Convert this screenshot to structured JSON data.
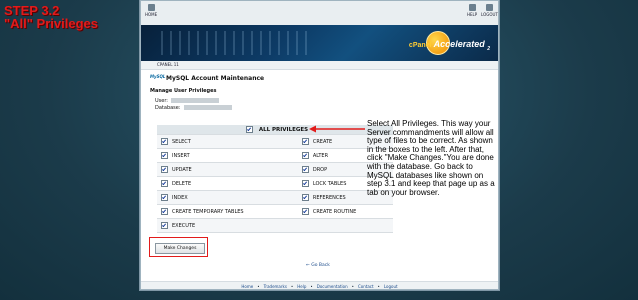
{
  "step_title": {
    "line1": "STEP 3.2",
    "line2": "\"All\" Privileges"
  },
  "toolbar": {
    "home": "HOME",
    "help": "HELP",
    "logout": "LOGOUT"
  },
  "banner": {
    "cpanel": "cPanel",
    "accelerated": "Accelerated",
    "version": "2"
  },
  "breadcrumb": "CPANEL 11",
  "mysql_logo": "MySQL",
  "page_title": "MySQL Account Maintenance",
  "subheading": "Manage User Privileges",
  "user_label": "User:",
  "database_label": "Database:",
  "all_privileges": "ALL PRIVILEGES",
  "privileges": [
    [
      "SELECT",
      "CREATE"
    ],
    [
      "INSERT",
      "ALTER"
    ],
    [
      "UPDATE",
      "DROP"
    ],
    [
      "DELETE",
      "LOCK TABLES"
    ],
    [
      "INDEX",
      "REFERENCES"
    ],
    [
      "CREATE TEMPORARY TABLES",
      "CREATE ROUTINE"
    ],
    [
      "EXECUTE",
      ""
    ]
  ],
  "make_changes": "Make Changes",
  "go_back": "← Go Back",
  "footer": [
    "Home",
    "Trademarks",
    "Help",
    "Documentation",
    "Contact",
    "Logout"
  ],
  "annotation": "Select All Privileges. This way your Server commandments will allow all type of files to be correct. As shown in the boxes to the left. After that, click \"Make Changes.\"You are done with the database. Go back to MySQL databases like shown on step 3.1 and keep that page up as a tab on your browser.",
  "colors": {
    "highlight": "#e21b1b",
    "background": "#1b3b4a",
    "link": "#1a4a8a"
  }
}
